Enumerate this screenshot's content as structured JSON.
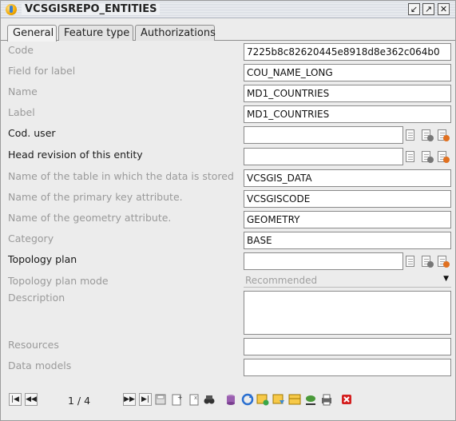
{
  "window": {
    "title": "VCSGISREPO_ENTITIES",
    "buttons": [
      "minimize",
      "maximize",
      "close"
    ]
  },
  "tabs": [
    {
      "label": "General",
      "active": true
    },
    {
      "label": "Feature type",
      "active": false
    },
    {
      "label": "Authorizations",
      "active": false
    }
  ],
  "form": {
    "code": {
      "label": "Code",
      "value": "7225b8c82620445e8918d8e362c064b0"
    },
    "field_for_label": {
      "label": "Field for label",
      "value": "COU_NAME_LONG"
    },
    "name": {
      "label": "Name",
      "value": "MD1_COUNTRIES"
    },
    "label": {
      "label": "Label",
      "value": "MD1_COUNTRIES"
    },
    "cod_user": {
      "label": "Cod. user",
      "value": ""
    },
    "head_revision": {
      "label": "Head revision of this entity",
      "value": ""
    },
    "table_name": {
      "label": "Name of the table in which the data is stored",
      "value": "VCSGIS_DATA"
    },
    "pk_attribute": {
      "label": "Name of the primary key attribute.",
      "value": "VCSGISCODE"
    },
    "geometry_attribute": {
      "label": "Name of the geometry attribute.",
      "value": "GEOMETRY"
    },
    "category": {
      "label": "Category",
      "value": "BASE"
    },
    "topology_plan": {
      "label": "Topology plan",
      "value": ""
    },
    "topology_plan_mode": {
      "label": "Topology plan mode",
      "value": "Recommended"
    },
    "description": {
      "label": "Description",
      "value": ""
    },
    "resources": {
      "label": "Resources",
      "value": ""
    },
    "data_models": {
      "label": "Data models",
      "value": ""
    }
  },
  "navigation": {
    "pager": "1 / 4"
  },
  "colors": {
    "disabled_label": "#9a9a9a",
    "enabled_label": "#1a1a1a",
    "delete_red": "#d42020"
  }
}
